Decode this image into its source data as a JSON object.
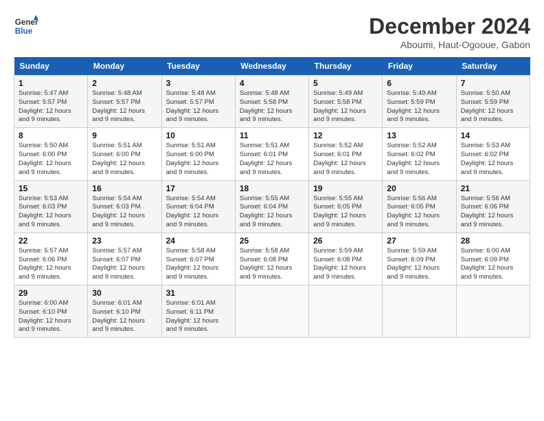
{
  "logo": {
    "line1": "General",
    "line2": "Blue"
  },
  "title": "December 2024",
  "location": "Aboumi, Haut-Ogooue, Gabon",
  "weekdays": [
    "Sunday",
    "Monday",
    "Tuesday",
    "Wednesday",
    "Thursday",
    "Friday",
    "Saturday"
  ],
  "weeks": [
    [
      {
        "day": "1",
        "rise": "5:47 AM",
        "set": "5:57 PM",
        "daylight": "12 hours and 9 minutes."
      },
      {
        "day": "2",
        "rise": "5:48 AM",
        "set": "5:57 PM",
        "daylight": "12 hours and 9 minutes."
      },
      {
        "day": "3",
        "rise": "5:48 AM",
        "set": "5:57 PM",
        "daylight": "12 hours and 9 minutes."
      },
      {
        "day": "4",
        "rise": "5:48 AM",
        "set": "5:58 PM",
        "daylight": "12 hours and 9 minutes."
      },
      {
        "day": "5",
        "rise": "5:49 AM",
        "set": "5:58 PM",
        "daylight": "12 hours and 9 minutes."
      },
      {
        "day": "6",
        "rise": "5:49 AM",
        "set": "5:59 PM",
        "daylight": "12 hours and 9 minutes."
      },
      {
        "day": "7",
        "rise": "5:50 AM",
        "set": "5:59 PM",
        "daylight": "12 hours and 9 minutes."
      }
    ],
    [
      {
        "day": "8",
        "rise": "5:50 AM",
        "set": "6:00 PM",
        "daylight": "12 hours and 9 minutes."
      },
      {
        "day": "9",
        "rise": "5:51 AM",
        "set": "6:00 PM",
        "daylight": "12 hours and 9 minutes."
      },
      {
        "day": "10",
        "rise": "5:51 AM",
        "set": "6:00 PM",
        "daylight": "12 hours and 9 minutes."
      },
      {
        "day": "11",
        "rise": "5:51 AM",
        "set": "6:01 PM",
        "daylight": "12 hours and 9 minutes."
      },
      {
        "day": "12",
        "rise": "5:52 AM",
        "set": "6:01 PM",
        "daylight": "12 hours and 9 minutes."
      },
      {
        "day": "13",
        "rise": "5:52 AM",
        "set": "6:02 PM",
        "daylight": "12 hours and 9 minutes."
      },
      {
        "day": "14",
        "rise": "5:53 AM",
        "set": "6:02 PM",
        "daylight": "12 hours and 9 minutes."
      }
    ],
    [
      {
        "day": "15",
        "rise": "5:53 AM",
        "set": "6:03 PM",
        "daylight": "12 hours and 9 minutes."
      },
      {
        "day": "16",
        "rise": "5:54 AM",
        "set": "6:03 PM",
        "daylight": "12 hours and 9 minutes."
      },
      {
        "day": "17",
        "rise": "5:54 AM",
        "set": "6:04 PM",
        "daylight": "12 hours and 9 minutes."
      },
      {
        "day": "18",
        "rise": "5:55 AM",
        "set": "6:04 PM",
        "daylight": "12 hours and 9 minutes."
      },
      {
        "day": "19",
        "rise": "5:55 AM",
        "set": "6:05 PM",
        "daylight": "12 hours and 9 minutes."
      },
      {
        "day": "20",
        "rise": "5:56 AM",
        "set": "6:05 PM",
        "daylight": "12 hours and 9 minutes."
      },
      {
        "day": "21",
        "rise": "5:56 AM",
        "set": "6:06 PM",
        "daylight": "12 hours and 9 minutes."
      }
    ],
    [
      {
        "day": "22",
        "rise": "5:57 AM",
        "set": "6:06 PM",
        "daylight": "12 hours and 9 minutes."
      },
      {
        "day": "23",
        "rise": "5:57 AM",
        "set": "6:07 PM",
        "daylight": "12 hours and 9 minutes."
      },
      {
        "day": "24",
        "rise": "5:58 AM",
        "set": "6:07 PM",
        "daylight": "12 hours and 9 minutes."
      },
      {
        "day": "25",
        "rise": "5:58 AM",
        "set": "6:08 PM",
        "daylight": "12 hours and 9 minutes."
      },
      {
        "day": "26",
        "rise": "5:59 AM",
        "set": "6:08 PM",
        "daylight": "12 hours and 9 minutes."
      },
      {
        "day": "27",
        "rise": "5:59 AM",
        "set": "6:09 PM",
        "daylight": "12 hours and 9 minutes."
      },
      {
        "day": "28",
        "rise": "6:00 AM",
        "set": "6:09 PM",
        "daylight": "12 hours and 9 minutes."
      }
    ],
    [
      {
        "day": "29",
        "rise": "6:00 AM",
        "set": "6:10 PM",
        "daylight": "12 hours and 9 minutes."
      },
      {
        "day": "30",
        "rise": "6:01 AM",
        "set": "6:10 PM",
        "daylight": "12 hours and 9 minutes."
      },
      {
        "day": "31",
        "rise": "6:01 AM",
        "set": "6:11 PM",
        "daylight": "12 hours and 9 minutes."
      },
      null,
      null,
      null,
      null
    ]
  ]
}
